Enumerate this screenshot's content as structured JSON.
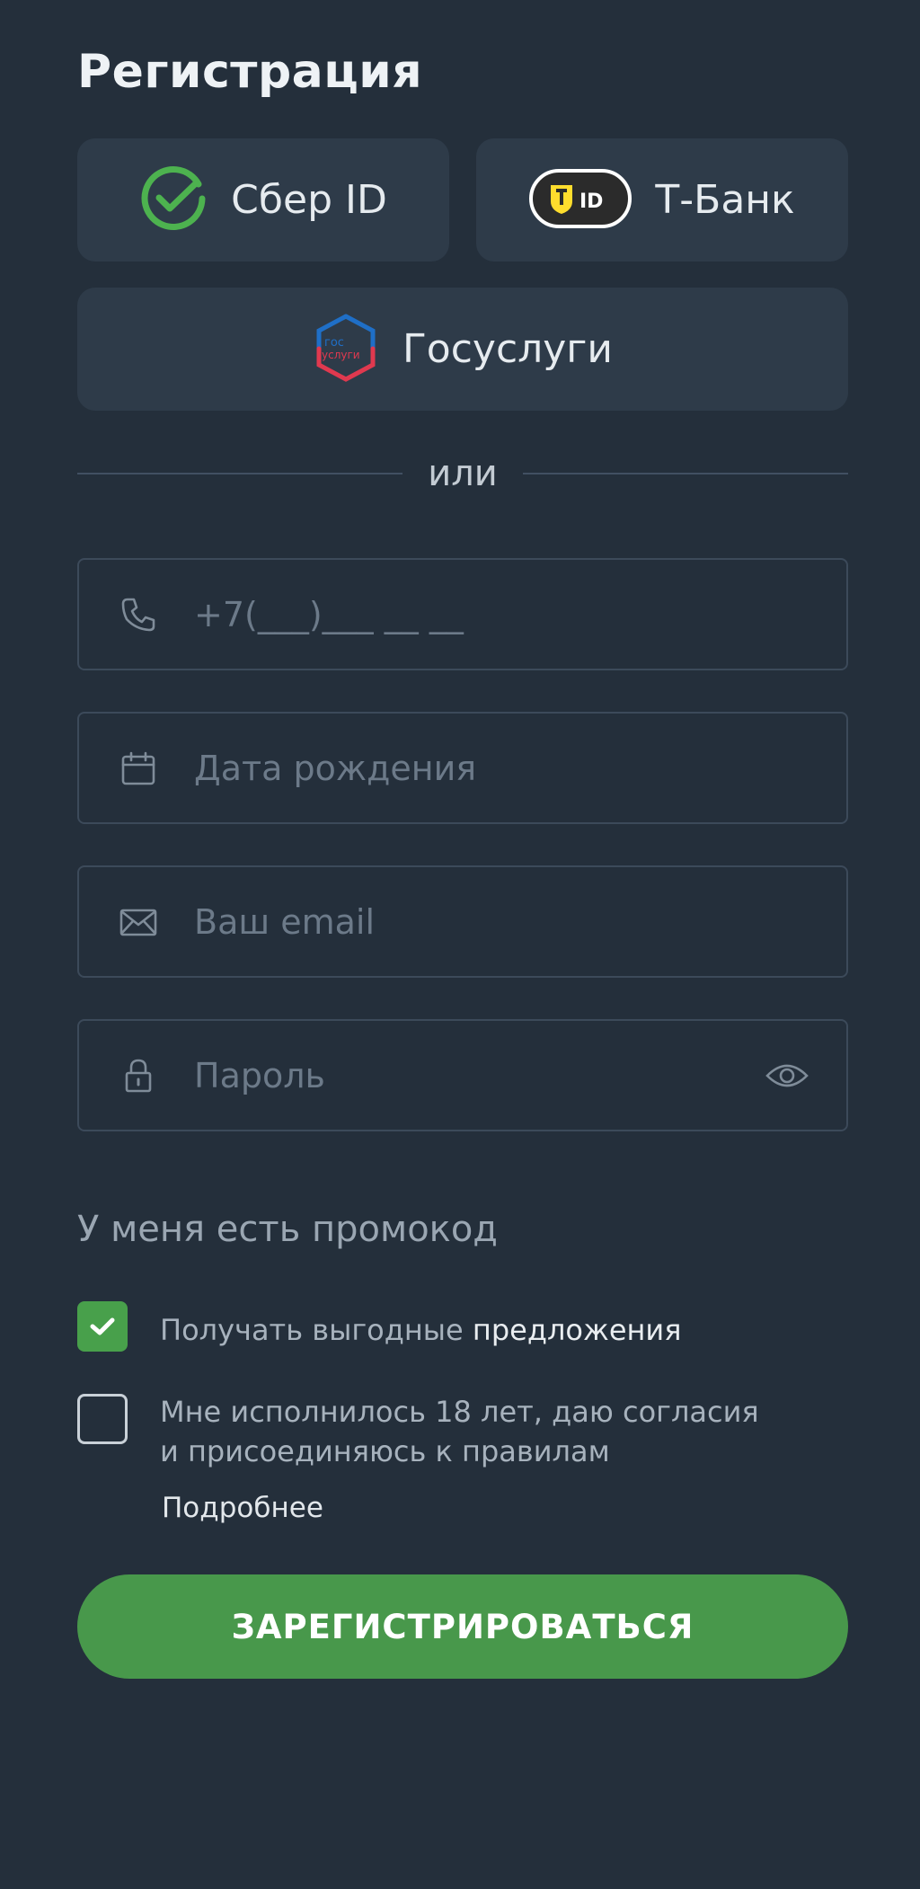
{
  "header": {
    "title": "Регистрация"
  },
  "providers": {
    "sber": {
      "label": "Сбер ID",
      "icon": "sber-check-icon",
      "color": "#4db24f"
    },
    "tbank": {
      "label": "Т-Банк",
      "badge": "ID",
      "icon": "tbank-id-icon",
      "color": "#ffdd2d"
    },
    "gosuslugi": {
      "label": "Госуслуги",
      "logo_line1": "гос",
      "logo_line2": "услуги",
      "icon": "gosuslugi-logo-icon"
    }
  },
  "divider": {
    "text": "или"
  },
  "form": {
    "phone": {
      "placeholder": "+7(___)___ __ __",
      "value": "",
      "icon": "phone-icon"
    },
    "birthdate": {
      "placeholder": "Дата рождения",
      "value": "",
      "icon": "calendar-icon"
    },
    "email": {
      "placeholder": "Ваш email",
      "value": "",
      "icon": "mail-icon"
    },
    "password": {
      "placeholder": "Пароль",
      "value": "",
      "icon": "lock-icon",
      "toggle_icon": "eye-icon"
    }
  },
  "promo": {
    "label": "У меня есть промокод"
  },
  "consents": {
    "offers": {
      "checked": true,
      "text_part1": "Получать выгодные ",
      "text_part2": "предложения"
    },
    "age": {
      "checked": false,
      "line1": "Мне исполнилось 18 лет, даю согласия",
      "line2": "и присоединяюсь к правилам",
      "more": "Подробнее"
    }
  },
  "submit": {
    "label": "ЗАРЕГИСТРИРОВАТЬСЯ",
    "color": "#48984b"
  }
}
